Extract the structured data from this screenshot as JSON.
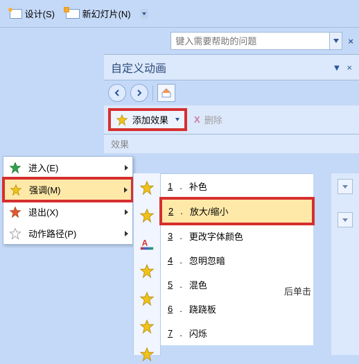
{
  "topbar": {
    "design_label": "设计(S)",
    "newslide_label": "新幻灯片(N)"
  },
  "help": {
    "placeholder": "键入需要帮助的问题"
  },
  "panel": {
    "title": "自定义动画"
  },
  "actions": {
    "add_effect": "添加效果",
    "delete": "删除",
    "effect_caption": "效果"
  },
  "context_menu": {
    "items": [
      {
        "label": "进入(E)",
        "star": "#2fa24a"
      },
      {
        "label": "强调(M)",
        "star": "#f2c21a"
      },
      {
        "label": "退出(X)",
        "star": "#e0592f"
      },
      {
        "label": "动作路径(P)",
        "star": "#ffffff"
      }
    ]
  },
  "sub_menu": {
    "items": [
      {
        "num": "1",
        "label": "补色"
      },
      {
        "num": "2",
        "label": "放大/缩小"
      },
      {
        "num": "3",
        "label": "更改字体颜色"
      },
      {
        "num": "4",
        "label": "忽明忽暗"
      },
      {
        "num": "5",
        "label": "混色"
      },
      {
        "num": "6",
        "label": "跷跷板"
      },
      {
        "num": "7",
        "label": "闪烁"
      }
    ]
  },
  "hint": "后单击"
}
